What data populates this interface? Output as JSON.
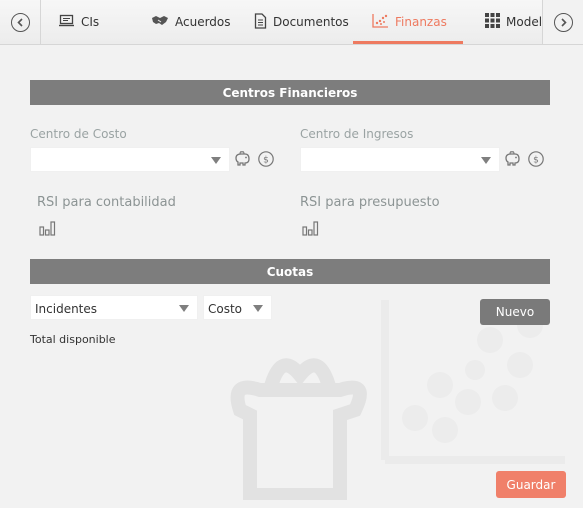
{
  "tabs": [
    {
      "label": "CIs",
      "icon": "ci-icon"
    },
    {
      "label": "Acuerdos",
      "icon": "handshake-icon"
    },
    {
      "label": "Documentos",
      "icon": "document-icon"
    },
    {
      "label": "Finanzas",
      "icon": "chart-icon",
      "active": true
    },
    {
      "label": "Model",
      "icon": "grid-icon"
    }
  ],
  "accent_color": "#ee7a60",
  "centros": {
    "header": "Centros Financieros",
    "costo_label": "Centro de Costo",
    "costo_value": "",
    "ingresos_label": "Centro de Ingresos",
    "ingresos_value": "",
    "rsi_contabilidad": "RSI para contabilidad",
    "rsi_presupuesto": "RSI para presupuesto"
  },
  "cuotas": {
    "header": "Cuotas",
    "tipo_value": "Incidentes",
    "medida_value": "Costo",
    "nuevo_label": "Nuevo",
    "total_label": "Total disponible"
  },
  "footer": {
    "guardar_label": "Guardar"
  }
}
